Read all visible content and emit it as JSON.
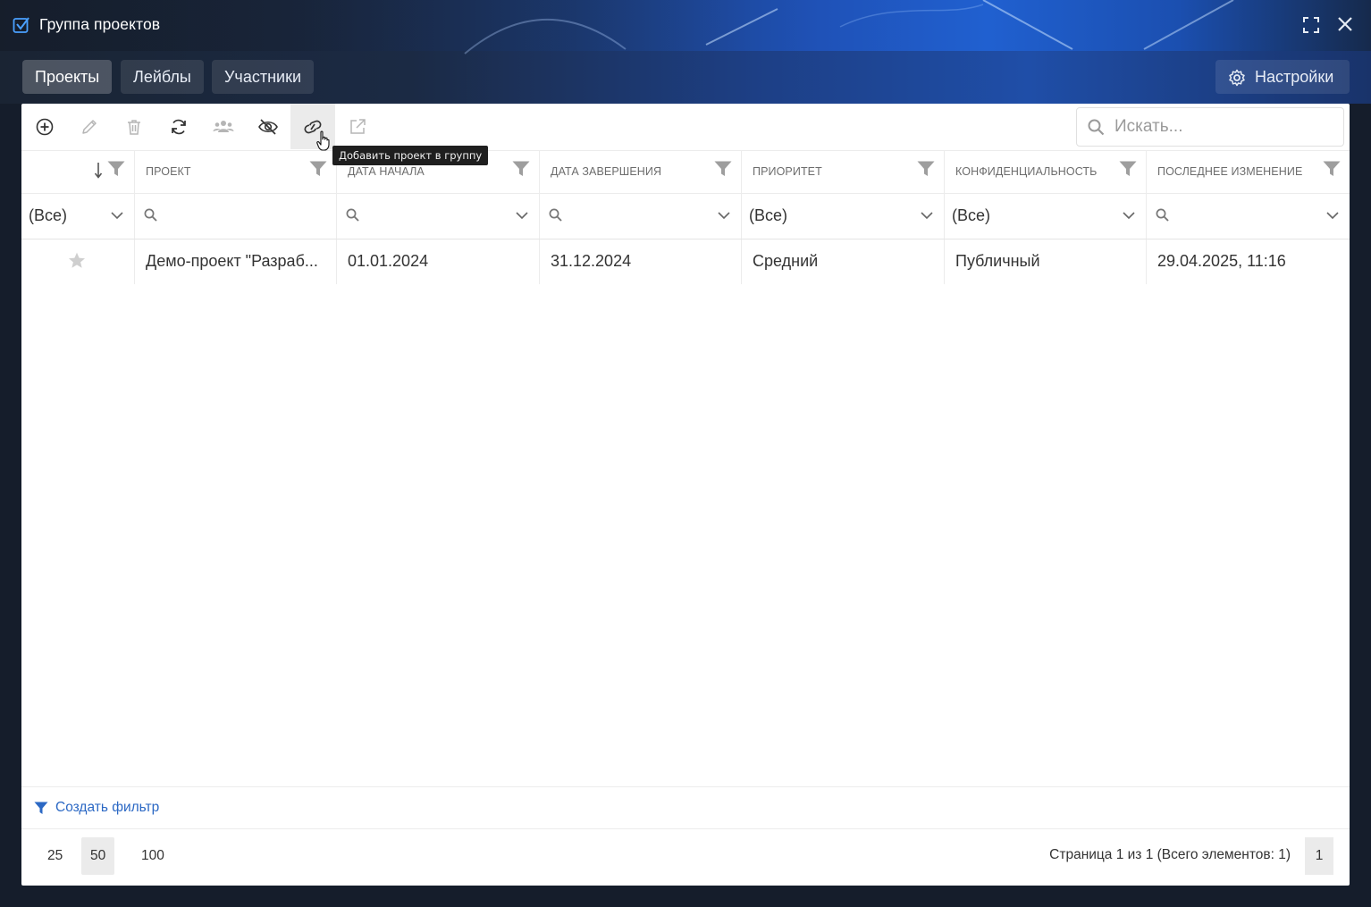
{
  "window": {
    "title": "Группа проектов"
  },
  "tabs": [
    {
      "label": "Проекты",
      "active": true
    },
    {
      "label": "Лейблы",
      "active": false
    },
    {
      "label": "Участники",
      "active": false
    }
  ],
  "settings": {
    "label": "Настройки"
  },
  "toolbar": {
    "buttons": [
      {
        "icon": "add-circle-icon",
        "enabled": true
      },
      {
        "icon": "pencil-icon",
        "enabled": false
      },
      {
        "icon": "trash-icon",
        "enabled": false
      },
      {
        "icon": "refresh-icon",
        "enabled": true
      },
      {
        "icon": "users-icon",
        "enabled": false
      },
      {
        "icon": "eye-off-icon",
        "enabled": true
      },
      {
        "icon": "link-icon",
        "enabled": true,
        "hovered": true
      },
      {
        "icon": "external-link-icon",
        "enabled": false
      }
    ],
    "tooltip": "Добавить проект в группу",
    "search_placeholder": "Искать..."
  },
  "grid": {
    "columns": [
      {
        "label": ""
      },
      {
        "label": "Проект"
      },
      {
        "label": "Дата начала"
      },
      {
        "label": "Дата завершения"
      },
      {
        "label": "Приоритет"
      },
      {
        "label": "Конфиденциальность"
      },
      {
        "label": "Последнее изменение"
      }
    ],
    "filters": [
      "(Все)",
      "",
      "",
      "",
      "(Все)",
      "(Все)",
      ""
    ],
    "rows": [
      {
        "favorite": false,
        "project": "Демо-проект \"Разраб...",
        "start": "01.01.2024",
        "end": "31.12.2024",
        "priority": "Средний",
        "privacy": "Публичный",
        "modified": "29.04.2025, 11:16"
      }
    ]
  },
  "footer": {
    "create_filter": "Создать фильтр",
    "page_sizes": [
      "25",
      "50",
      "100"
    ],
    "selected_page_size": "50",
    "page_info": "Страница 1 из 1 (Всего элементов: 1)",
    "current_page": "1"
  },
  "colors": {
    "accent": "#2b68c4",
    "header_blue": "#1f52b8"
  }
}
